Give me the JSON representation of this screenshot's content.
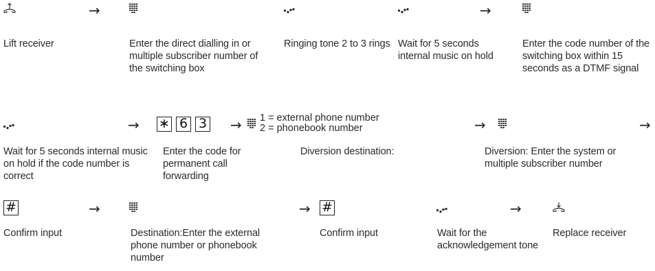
{
  "row1": {
    "steps": [
      "Lift receiver",
      "Enter the direct dialling in or multiple subscriber number of the switching box",
      "Ringing tone 2 to 3 rings",
      "Wait for 5 seconds internal music on hold",
      "Enter the code number of the switching box within 15 seconds as a DTMF signal"
    ]
  },
  "row2": {
    "keys": [
      "∗",
      "6",
      "3"
    ],
    "options": [
      "1 = external phone number",
      "2 = phonebook number"
    ],
    "steps": [
      "Wait for 5 seconds internal music on hold if the code number is correct",
      "Enter the code for permanent call forwarding",
      "Diversion destination:",
      "Diversion: Enter the system or multiple subscriber number"
    ]
  },
  "row3": {
    "keys": [
      "#",
      "#"
    ],
    "steps": [
      "Confirm input",
      "Destination:Enter the external phone number or phonebook number",
      "Confirm input",
      "Wait for the acknowledgement tone",
      "Replace receiver"
    ]
  },
  "arrow_glyph": "→",
  "icons": [
    "lift-receiver-icon",
    "keypad-icon",
    "ringing-tone-icon",
    "replace-receiver-icon",
    "hash-key-icon",
    "star-key-icon"
  ]
}
